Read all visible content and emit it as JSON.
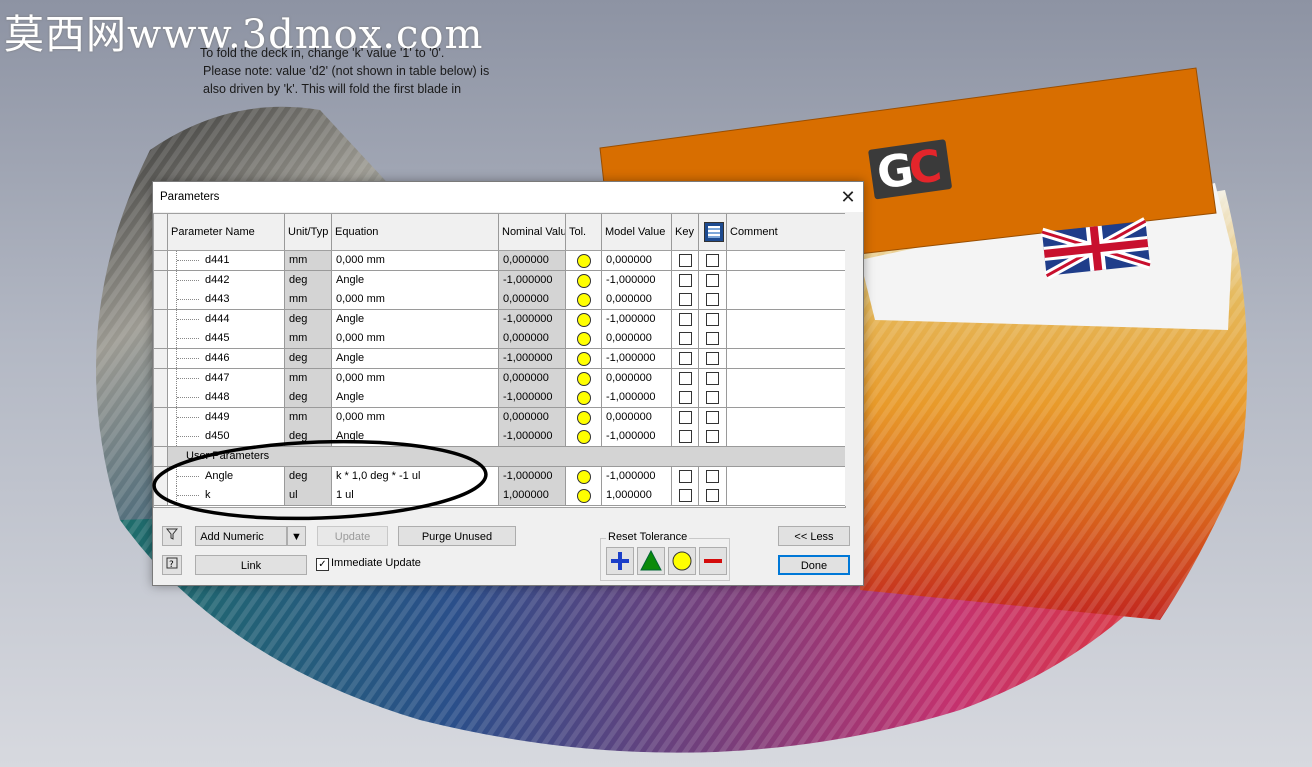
{
  "watermark": "莫西网www.3dmox.com",
  "note": {
    "line1": "To fold the deck in, change 'k' value '1' to '0'.",
    "line2": "Please note: value 'd2' (not shown in table below) is",
    "line3": "also driven by 'k'. This will fold the first blade in"
  },
  "scene": {
    "logo": "GC",
    "card_color": "#d86e00"
  },
  "dialog": {
    "title": "Parameters",
    "close_glyph": "✕",
    "columns": {
      "name": "Parameter Name",
      "unit": "Unit/Typ",
      "equation": "Equation",
      "nominal": "Nominal Valu",
      "tol": "Tol.",
      "model": "Model Value",
      "key": "Key",
      "comment": "Comment"
    },
    "rows": [
      {
        "name": "d441",
        "unit": "mm",
        "equation": "0,000 mm",
        "nominal": "0,000000",
        "model": "0,000000"
      },
      {
        "name": "d442",
        "unit": "deg",
        "equation": "Angle",
        "nominal": "-1,000000",
        "model": "-1,000000"
      },
      {
        "name": "d443",
        "unit": "mm",
        "equation": "0,000 mm",
        "nominal": "0,000000",
        "model": "0,000000"
      },
      {
        "name": "d444",
        "unit": "deg",
        "equation": "Angle",
        "nominal": "-1,000000",
        "model": "-1,000000"
      },
      {
        "name": "d445",
        "unit": "mm",
        "equation": "0,000 mm",
        "nominal": "0,000000",
        "model": "0,000000"
      },
      {
        "name": "d446",
        "unit": "deg",
        "equation": "Angle",
        "nominal": "-1,000000",
        "model": "-1,000000"
      },
      {
        "name": "d447",
        "unit": "mm",
        "equation": "0,000 mm",
        "nominal": "0,000000",
        "model": "0,000000"
      },
      {
        "name": "d448",
        "unit": "deg",
        "equation": "Angle",
        "nominal": "-1,000000",
        "model": "-1,000000"
      },
      {
        "name": "d449",
        "unit": "mm",
        "equation": "0,000 mm",
        "nominal": "0,000000",
        "model": "0,000000"
      },
      {
        "name": "d450",
        "unit": "deg",
        "equation": "Angle",
        "nominal": "-1,000000",
        "model": "-1,000000"
      }
    ],
    "user_group": "User Parameters",
    "user_rows": [
      {
        "name": "Angle",
        "unit": "deg",
        "equation": "k * 1,0 deg * -1 ul",
        "nominal": "-1,000000",
        "model": "-1,000000"
      },
      {
        "name": "k",
        "unit": "ul",
        "equation": "1 ul",
        "nominal": "1,000000",
        "model": "1,000000"
      }
    ],
    "buttons": {
      "add_numeric": "Add Numeric",
      "update": "Update",
      "purge_unused": "Purge Unused",
      "link": "Link",
      "immediate_update": "Immediate Update",
      "less": "<< Less",
      "done": "Done",
      "reset_tolerance": "Reset Tolerance"
    },
    "immediate_update_checked": true,
    "tolerance_color": "#ffff00"
  }
}
